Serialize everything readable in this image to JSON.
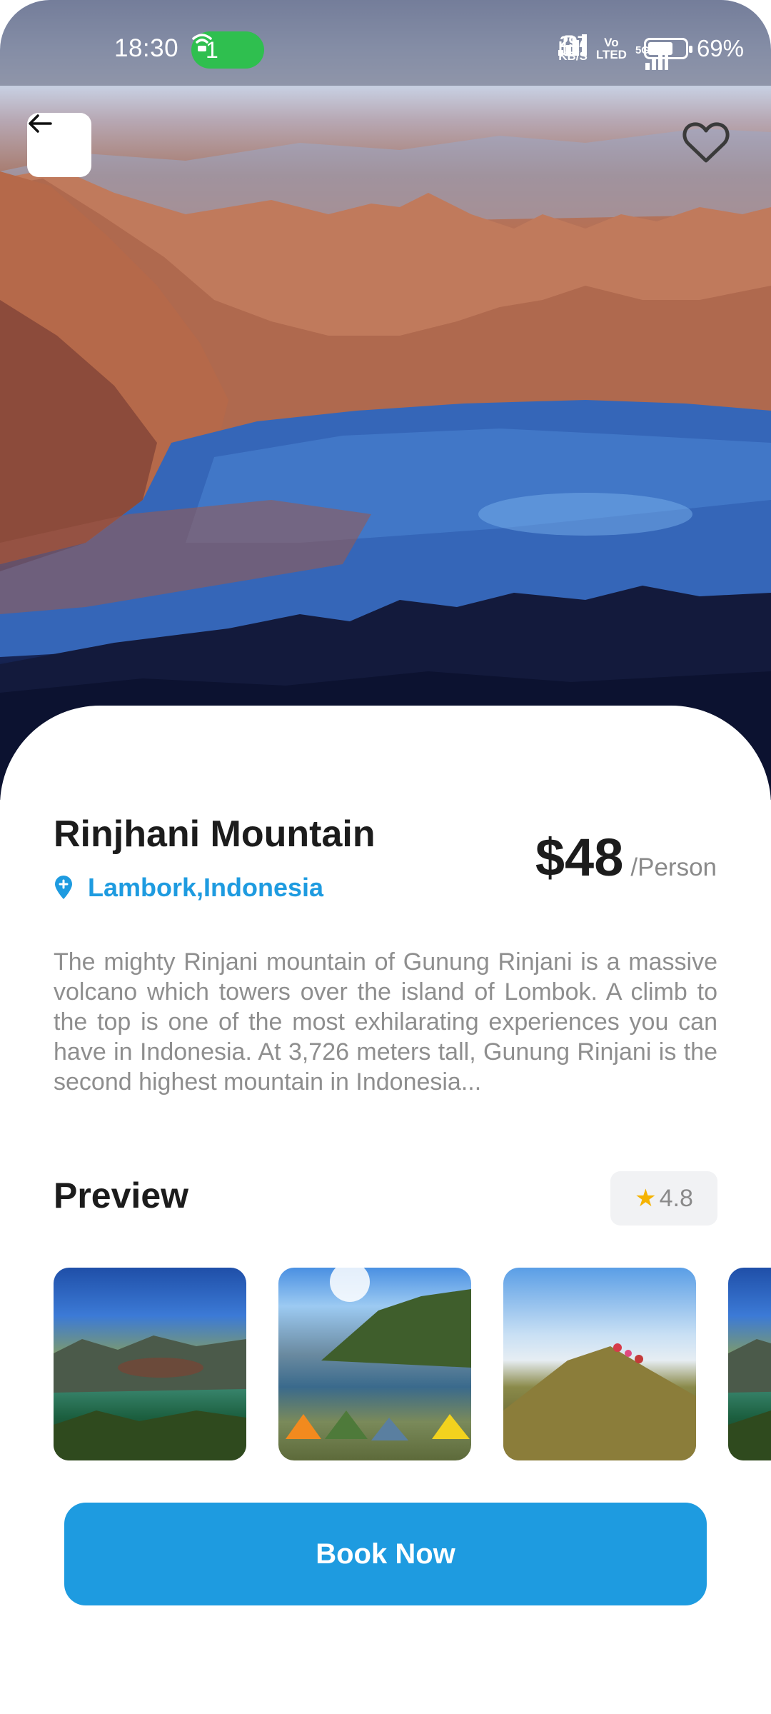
{
  "status_bar": {
    "time": "18:30",
    "hotspot_count": "1",
    "net_speed_value": "297",
    "net_speed_unit": "KB/S",
    "volte_top": "Vo",
    "volte_bottom": "LTED",
    "network_type": "5G",
    "battery_level": 0.69,
    "battery_label": "69%"
  },
  "destination": {
    "title": "Rinjhani Mountain",
    "location": "Lambork,Indonesia",
    "price": "$48",
    "price_unit": "/Person",
    "description": "The mighty Rinjani mountain of Gunung Rinjani is a massive volcano which towers over the island of Lombok. A climb to the top is one of the most exhilarating experiences you can have in Indonesia. At 3,726 meters tall, Gunung Rinjani is the second highest mountain in Indonesia..."
  },
  "preview": {
    "title": "Preview",
    "rating": "4.8"
  },
  "actions": {
    "book_label": "Book Now"
  },
  "colors": {
    "accent": "#1e9be0",
    "rating_star": "#f5b301",
    "hotspot": "#2fbf4f"
  },
  "icons": {
    "back": "arrow-left-icon",
    "favorite": "heart-outline-icon",
    "location": "location-pin-icon",
    "rating": "star-icon"
  }
}
